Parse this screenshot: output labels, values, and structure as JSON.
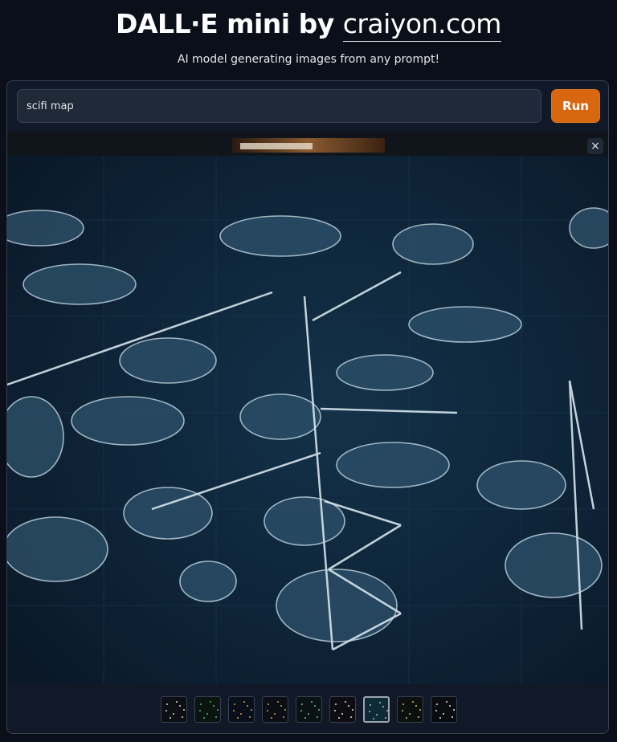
{
  "header": {
    "title_prefix": "DALL·E mini by ",
    "title_link": "craiyon.com",
    "subtitle": "AI model generating images from any prompt!"
  },
  "prompt": {
    "value": "scifi map"
  },
  "run_button": {
    "label": "Run"
  },
  "preview": {
    "close_glyph": "×",
    "image": "scifi-map-generated-image"
  },
  "thumbnails": [
    {
      "color": "#0d0f14",
      "dot": "#d6d6d6",
      "selected": false
    },
    {
      "color": "#0c1410",
      "dot": "#3fbf6e",
      "selected": false
    },
    {
      "color": "#0a0f1c",
      "dot": "#e0a238",
      "selected": false
    },
    {
      "color": "#0b0e14",
      "dot": "#dba23a",
      "selected": false
    },
    {
      "color": "#0a1214",
      "dot": "#6bbf9f",
      "selected": false
    },
    {
      "color": "#0d0d12",
      "dot": "#e0e0e0",
      "selected": false
    },
    {
      "color": "#0e2a36",
      "dot": "#9cc4d6",
      "selected": true
    },
    {
      "color": "#0c100e",
      "dot": "#d4c070",
      "selected": false
    },
    {
      "color": "#0b0c10",
      "dot": "#e2e2e2",
      "selected": false
    }
  ]
}
